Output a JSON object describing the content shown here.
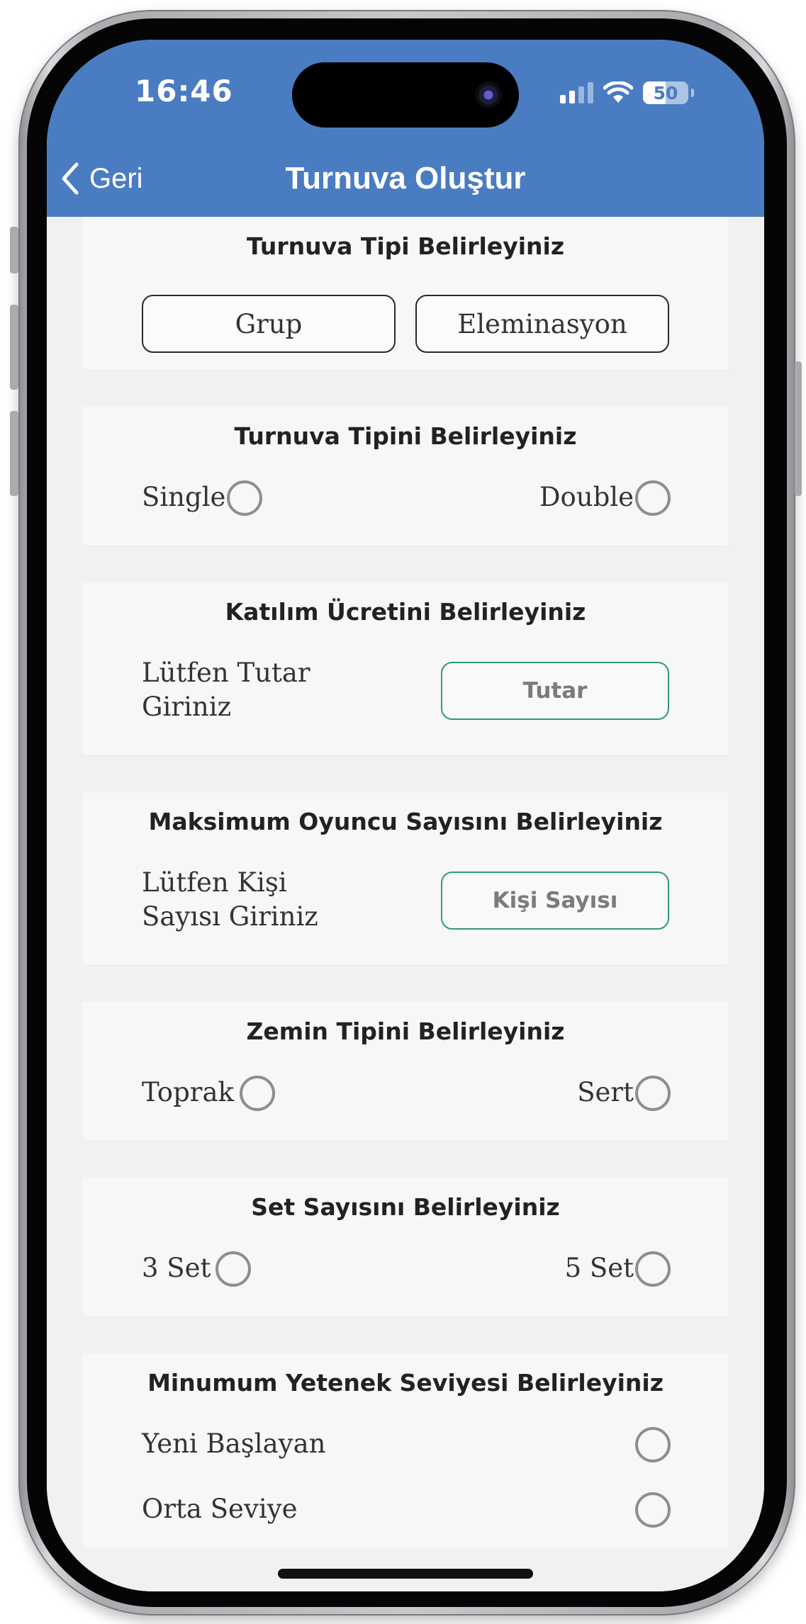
{
  "status_bar": {
    "time": "16:46",
    "battery": "50"
  },
  "nav": {
    "back_label": "Geri",
    "title": "Turnuva Oluştur"
  },
  "sections": {
    "tournament_format": {
      "title": "Turnuva Tipi Belirleyiniz",
      "options": [
        "Grup",
        "Eleminasyon"
      ]
    },
    "tournament_type": {
      "title": "Turnuva Tipini Belirleyiniz",
      "options": [
        "Single",
        "Double"
      ]
    },
    "fee": {
      "title": "Katılım Ücretini Belirleyiniz",
      "label_line1": "Lütfen Tutar",
      "label_line2": "Giriniz",
      "input_placeholder": "Tutar"
    },
    "max_players": {
      "title": "Maksimum Oyuncu Sayısını Belirleyiniz",
      "label_line1": "Lütfen Kişi",
      "label_line2": "Sayısı Giriniz",
      "input_placeholder": "Kişi Sayısı"
    },
    "surface": {
      "title": "Zemin Tipini Belirleyiniz",
      "options": [
        "Toprak",
        "Sert"
      ]
    },
    "sets": {
      "title": "Set Sayısını Belirleyiniz",
      "options": [
        "3 Set",
        "5 Set"
      ]
    },
    "skill": {
      "title": "Minumum Yetenek Seviyesi Belirleyiniz",
      "options": [
        "Yeni Başlayan",
        "Orta Seviye"
      ]
    }
  },
  "colors": {
    "header": "#4a7cc2",
    "input_border": "#2e9a6f",
    "background": "#f1f1f1"
  },
  "icons": {
    "back": "chevron-left-icon",
    "signal": "cellular-signal-icon",
    "wifi": "wifi-icon",
    "battery": "battery-icon"
  }
}
